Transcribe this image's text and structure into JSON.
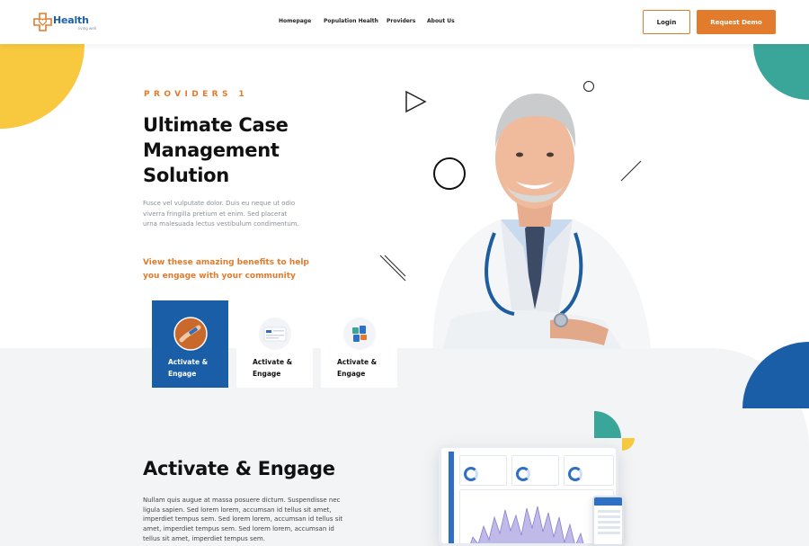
{
  "header": {
    "logo_text": "Health",
    "logo_subtext": "living well",
    "nav": [
      "Homepage",
      "Population Health",
      "Providers",
      "About Us"
    ],
    "login_label": "Login",
    "request_demo_label": "Request Demo"
  },
  "hero": {
    "eyebrow": "PROVIDERS 1",
    "title": "Ultimate Case Management Solution",
    "description": "Fusce vel vulputate dolor. Duis eu neque ut odio viverra fringilla pretium et enim. Sed placerat urna malesuada lectus vestibulum condimentum.",
    "benefit": "View these amazing benefits to help you engage with your community"
  },
  "cards": [
    {
      "label": "Activate & Engage",
      "icon": "vaccine-icon",
      "active": true
    },
    {
      "label": "Activate & Engage",
      "icon": "dashboard-icon",
      "active": false
    },
    {
      "label": "Activate & Engage",
      "icon": "puzzle-icon",
      "active": false
    }
  ],
  "section": {
    "title": "Activate & Engage",
    "description": "Nullam quis augue at massa posuere dictum. Suspendisse nec ligula sapien. Sed lorem lorem, accumsan id tellus sit amet, imperdiet tempus sem. Sed lorem lorem, accumsan id tellus sit amet, imperdiet tempus sem. Sed lorem lorem, accumsan id tellus sit amet, imperdiet tempus sem."
  },
  "colors": {
    "accent_orange": "#e27b2c",
    "brand_blue": "#1b5ea8",
    "teal": "#3aa699",
    "yellow": "#f8c93e"
  }
}
